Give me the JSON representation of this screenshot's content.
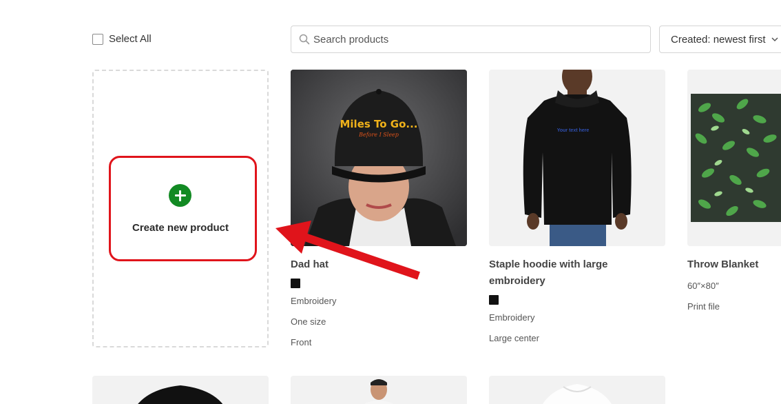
{
  "toolbar": {
    "select_all_label": "Select All",
    "search_placeholder": "Search products",
    "sort_label": "Created: newest first"
  },
  "create_card": {
    "label": "Create new product"
  },
  "products": [
    {
      "title": "Dad hat",
      "swatch_color": "#111111",
      "attributes": [
        "Embroidery",
        "One size",
        "Front"
      ],
      "image_text_main": "Miles To Go...",
      "image_text_sub": "Before I Sleep"
    },
    {
      "title": "Staple hoodie with large embroidery",
      "swatch_color": "#111111",
      "attributes": [
        "Embroidery",
        "Large center"
      ],
      "image_text_main": "Your text here"
    },
    {
      "title": "Throw Blanket",
      "attributes": [
        "60″×80″",
        "Print file"
      ]
    }
  ],
  "colors": {
    "accent_red": "#e0141b",
    "plus_green": "#128a23"
  }
}
